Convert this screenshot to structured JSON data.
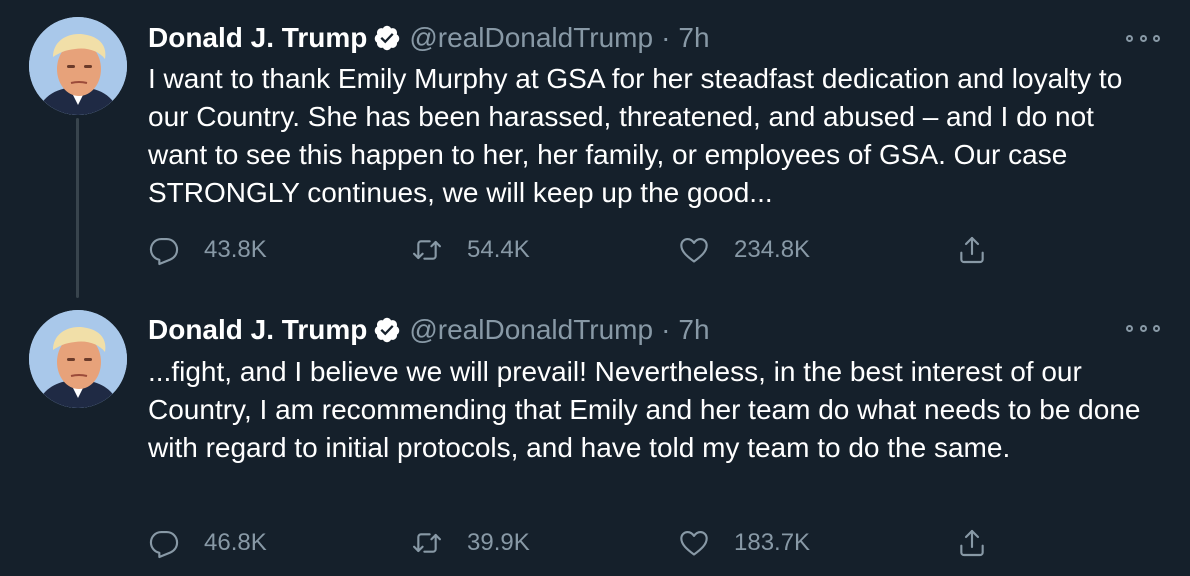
{
  "colors": {
    "background": "#15202b",
    "text_primary": "#ffffff",
    "text_secondary": "#8899a6",
    "verified_badge": "#ffffff",
    "thread_line": "#38444d"
  },
  "tweets": [
    {
      "author": {
        "display_name": "Donald J. Trump",
        "handle": "@realDonaldTrump",
        "verified_icon": "verified-badge-icon"
      },
      "separator": "·",
      "time": "7h",
      "text": "I want to thank Emily Murphy at GSA for her steadfast dedication and loyalty to our Country. She has been harassed, threatened, and abused – and I do not want to see this happen to her, her family, or employees of GSA. Our case STRONGLY continues, we will keep up the good...",
      "metrics": {
        "replies": "43.8K",
        "retweets": "54.4K",
        "likes": "234.8K"
      }
    },
    {
      "author": {
        "display_name": "Donald J. Trump",
        "handle": "@realDonaldTrump",
        "verified_icon": "verified-badge-icon"
      },
      "separator": "·",
      "time": "7h",
      "text": "...fight, and I believe we will prevail! Nevertheless, in the best interest of our Country, I am recommending that Emily and her team do what needs to be done with regard to initial protocols, and have told my team to do the same.",
      "metrics": {
        "replies": "46.8K",
        "retweets": "39.9K",
        "likes": "183.7K"
      }
    }
  ]
}
